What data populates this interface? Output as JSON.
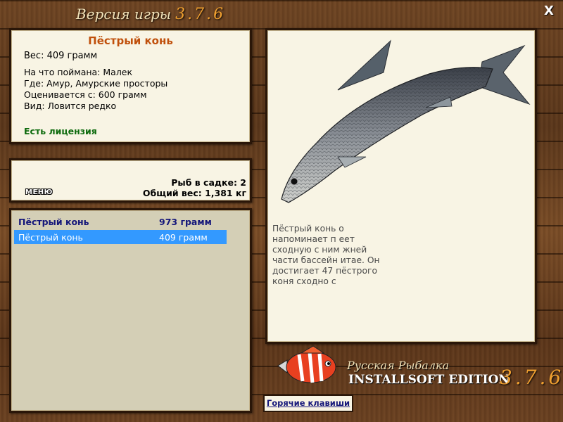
{
  "header": {
    "title": "Версия игры",
    "version": "3.7.6",
    "close_label": "X"
  },
  "info": {
    "fish_name": "Пёстрый конь",
    "weight": "Вес: 409 грамм",
    "caught_on": "На что поймана: Малек",
    "where": "Где: Амур, Амурские просторы",
    "rated_from": "Оценивается с: 600 грамм",
    "kind": "Вид: Ловится редко",
    "license": "Есть лицензия"
  },
  "keep": {
    "menu_label": "МЕНЮ",
    "fish_count": "Рыб в садке: 2",
    "total_weight": "Общий вес: 1,381 кг"
  },
  "list": {
    "rows": [
      {
        "name": "Пёстрый конь",
        "weight": "973 грамм"
      },
      {
        "name": "Пёстрый конь",
        "weight": "409 грамм"
      }
    ]
  },
  "description": {
    "lines": [
      "Пёстрый конь                                                    о",
      "напоминает п                                                   еет",
      "сходную с ним                                                 жней",
      "части бассейн                                             итае. Он",
      "достигает 47                                               пёстрого",
      "коня сходно с"
    ]
  },
  "logo": {
    "line1": "Русская Рыбалка",
    "line2": "INSTALLSOFT EDITION",
    "version": "3.7.6"
  },
  "hotkeys_label": "Горячие клавиши",
  "colors": {
    "fish_name": "#c0500c",
    "license": "#0c6a0c",
    "list_header": "#14167a",
    "selection": "#3399ff",
    "version": "#f0a030"
  }
}
